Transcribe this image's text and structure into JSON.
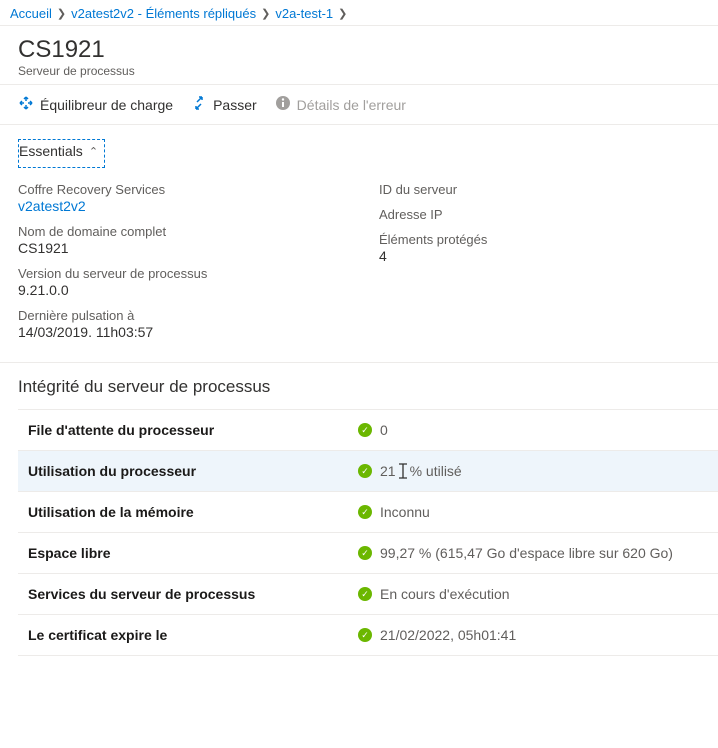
{
  "breadcrumb": {
    "items": [
      "Accueil",
      "v2atest2v2 - Éléments répliqués",
      "v2a-test-1"
    ]
  },
  "header": {
    "title": "CS1921",
    "subtitle": "Serveur de processus"
  },
  "toolbar": {
    "load_balancer": "Équilibreur de charge",
    "switch": "Passer",
    "error_details": "Détails de l'erreur"
  },
  "essentials": {
    "label": "Essentials",
    "left": [
      {
        "label": "Coffre Recovery Services",
        "value": "v2atest2v2",
        "link": true
      },
      {
        "label": "Nom de domaine complet",
        "value": "CS1921"
      },
      {
        "label": "Version du serveur de processus",
        "value": "9.21.0.0"
      },
      {
        "label": "Dernière pulsation à",
        "value": "14/03/2019. 11h03:57"
      }
    ],
    "right": [
      {
        "label": "ID du serveur",
        "value": ""
      },
      {
        "label": "Adresse IP",
        "value": ""
      },
      {
        "label": "Éléments protégés",
        "value": "4"
      }
    ]
  },
  "health": {
    "title": "Intégrité du serveur de processus",
    "rows": [
      {
        "label": "File d'attente du processeur",
        "value": "0"
      },
      {
        "label": "Utilisation du processeur",
        "value_pre": "21",
        "value_post": "% utilisé",
        "highlight": true
      },
      {
        "label": "Utilisation de la mémoire",
        "value": "Inconnu"
      },
      {
        "label": "Espace libre",
        "value": "99,27 % (615,47 Go d'espace libre sur 620 Go)"
      },
      {
        "label": "Services du serveur de processus",
        "value": "En cours d'exécution"
      },
      {
        "label": "Le certificat expire le",
        "value": "21/02/2022, 05h01:41"
      }
    ]
  }
}
